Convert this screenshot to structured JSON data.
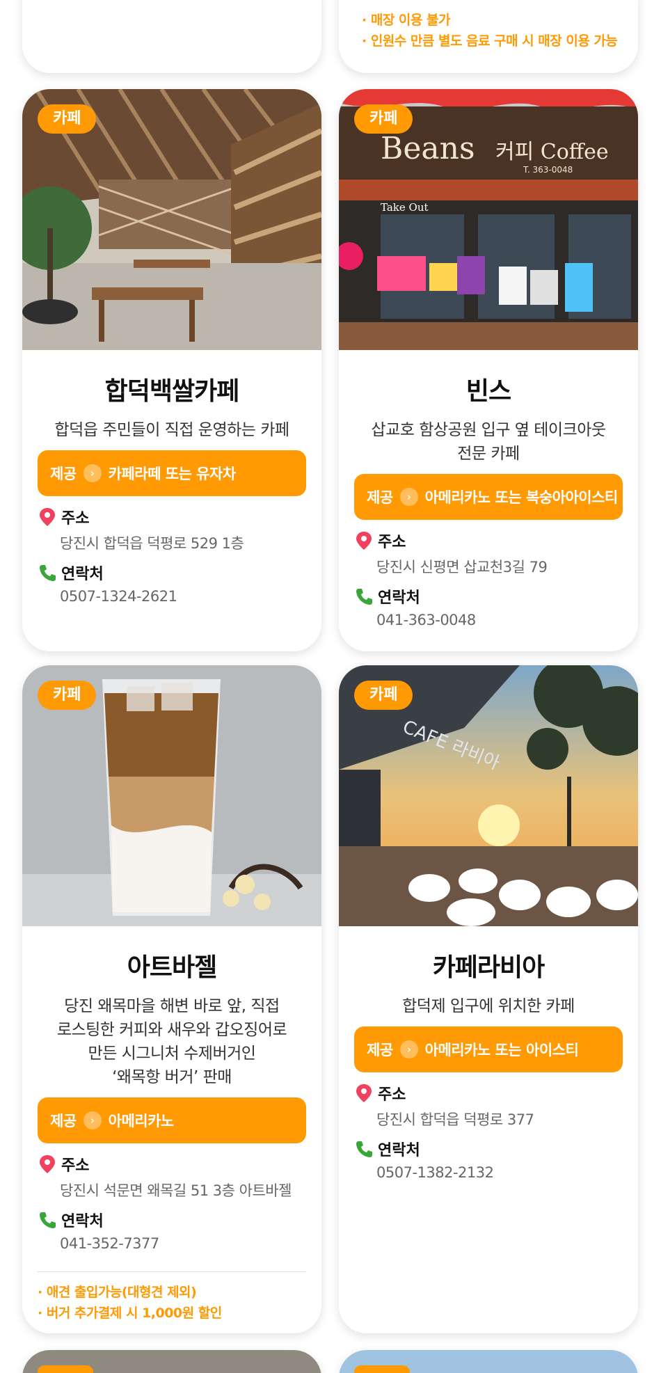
{
  "top_notes": [
    "· 매장 이용 불가",
    "· 인원수 만큼 별도 음료 구매 시 매장 이용 가능"
  ],
  "labels": {
    "offer": "제공",
    "address": "주소",
    "contact": "연락처"
  },
  "cards": [
    {
      "badge": "카페",
      "name": "합덕백쌀카페",
      "desc": [
        "합덕읍 주민들이 직접 운영하는 카페"
      ],
      "offer": "카페라떼 또는 유자차",
      "address": "당진시 합덕읍 덕평로 529 1층",
      "phone": "0507-1324-2621"
    },
    {
      "badge": "카페",
      "name": "빈스",
      "desc": [
        "삽교호 함상공원 입구 옆 테이크아웃",
        "전문 카페"
      ],
      "offer": "아메리카노 또는 복숭아아이스티",
      "address": "당진시 신평면 삽교천3길 79",
      "phone": "041-363-0048",
      "sign": {
        "brand": "Beans",
        "sub": "커피 Coffee",
        "tel": "T. 363-0048",
        "takeout": "Take Out"
      }
    },
    {
      "badge": "카페",
      "name": "아트바젤",
      "desc": [
        "당진 왜목마을 해변 바로 앞, 직접",
        "로스팅한 커피와 새우와 갑오징어로",
        "만든 시그니처 수제버거인",
        "‘왜목항 버거’ 판매"
      ],
      "offer": "아메리카노",
      "address": "당진시 석문면 왜목길 51 3층 아트바젤",
      "phone": "041-352-7377",
      "notes": [
        "· 애견 출입가능(대형견 제외)",
        "· 버거 추가결제 시 1,000원 할인"
      ]
    },
    {
      "badge": "카페",
      "name": "카페라비아",
      "desc": [
        "합덕제 입구에 위치한 카페"
      ],
      "offer": "아메리카노 또는 아이스티",
      "address": "당진시 합덕읍 덕평로 377",
      "phone": "0507-1382-2132",
      "sign": "CAFE 라비아"
    }
  ],
  "colors": {
    "accent": "#ff9a05",
    "pin": "#f0425f",
    "phone": "#3aa63a"
  },
  "icons": {
    "address": "map-pin-icon",
    "contact": "phone-icon",
    "offer_arrow": "chevron-right-icon"
  }
}
